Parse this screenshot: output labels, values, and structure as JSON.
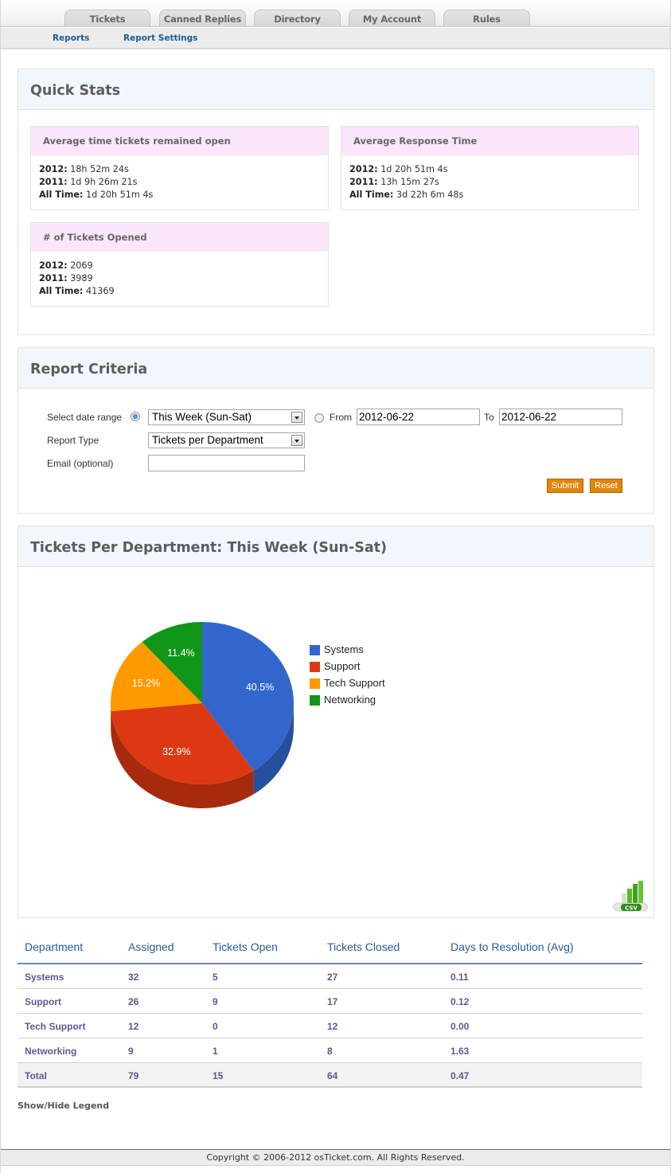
{
  "nav": {
    "tabs": [
      "Tickets",
      "Canned Replies",
      "Directory",
      "My Account",
      "Rules"
    ],
    "subtabs": [
      "Reports",
      "Report Settings"
    ]
  },
  "quick_stats": {
    "title": "Quick Stats",
    "boxes": [
      {
        "title": "Average time tickets remained open",
        "rows": [
          {
            "label": "2012:",
            "value": "18h 52m 24s"
          },
          {
            "label": "2011:",
            "value": "1d 9h 26m 21s"
          },
          {
            "label": "All Time:",
            "value": "1d 20h 51m 4s"
          }
        ]
      },
      {
        "title": "Average Response Time",
        "rows": [
          {
            "label": "2012:",
            "value": "1d 20h 51m 4s"
          },
          {
            "label": "2011:",
            "value": "13h 15m 27s"
          },
          {
            "label": "All Time:",
            "value": "3d 22h 6m 48s"
          }
        ]
      },
      {
        "title": "# of Tickets Opened",
        "rows": [
          {
            "label": "2012:",
            "value": "2069"
          },
          {
            "label": "2011:",
            "value": "3989"
          },
          {
            "label": "All Time:",
            "value": "41369"
          }
        ]
      }
    ]
  },
  "criteria": {
    "title": "Report Criteria",
    "date_range_label": "Select date range",
    "date_range_value": "This Week (Sun-Sat)",
    "from_label": "From",
    "from_value": "2012-06-22",
    "to_label": "To",
    "to_value": "2012-06-22",
    "report_type_label": "Report Type",
    "report_type_value": "Tickets per Department",
    "email_label": "Email (optional)",
    "email_value": "",
    "submit_label": "Submit",
    "reset_label": "Reset"
  },
  "report": {
    "title": "Tickets Per Department: This Week (Sun-Sat)",
    "csv_label": "CSV"
  },
  "chart_data": {
    "type": "pie",
    "title": "",
    "three_d": true,
    "legend_position": "right",
    "categories": [
      "Systems",
      "Support",
      "Tech Support",
      "Networking"
    ],
    "values": [
      32,
      26,
      12,
      9
    ],
    "labels": [
      "40.5%",
      "32.9%",
      "15.2%",
      "11.4%"
    ],
    "colors": [
      "#3366cc",
      "#dc3912",
      "#ff9900",
      "#109618"
    ],
    "shadow_colors": [
      "#26509c",
      "#a82a0d",
      "#c47500",
      "#0b6f12"
    ]
  },
  "table": {
    "headers": [
      "Department",
      "Assigned",
      "Tickets Open",
      "Tickets Closed",
      "Days to Resolution (Avg)"
    ],
    "rows": [
      [
        "Systems",
        "32",
        "5",
        "27",
        "0.11"
      ],
      [
        "Support",
        "26",
        "9",
        "17",
        "0.12"
      ],
      [
        "Tech Support",
        "12",
        "0",
        "12",
        "0.00"
      ],
      [
        "Networking",
        "9",
        "1",
        "8",
        "1.63"
      ]
    ],
    "total": [
      "Total",
      "79",
      "15",
      "64",
      "0.47"
    ]
  },
  "legend_toggle": "Show/Hide Legend",
  "footer": "Copyright © 2006-2012 osTicket.com.  All Rights Reserved."
}
